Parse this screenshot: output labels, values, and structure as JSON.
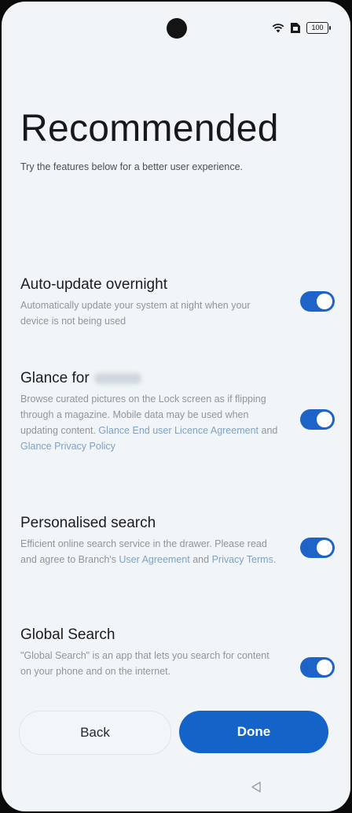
{
  "status_bar": {
    "battery": "100"
  },
  "header": {
    "title": "Recommended",
    "subtitle": "Try the features below for a better user experience."
  },
  "settings": [
    {
      "title": "Auto-update overnight",
      "desc": "Automatically update your system at night when your device is not being used",
      "enabled": true
    },
    {
      "title": "Glance for",
      "desc_plain_1": "Browse curated pictures on the Lock screen as if flipping through a magazine. Mobile data may be used when updating content.",
      "link_1": "Glance End user Licence Agreement",
      "desc_plain_2": "and",
      "link_2": "Glance Privacy Policy",
      "enabled": true
    },
    {
      "title": "Personalised search",
      "desc_plain_1": "Efficient online search service in the drawer. Please read and agree to Branch's",
      "link_1": "User Agreement",
      "desc_plain_2": "and",
      "link_2": "Privacy Terms",
      "desc_end": ".",
      "enabled": true
    },
    {
      "title": "Global Search",
      "desc": "\"Global Search\" is an app that lets you search for content on your phone and on the internet.",
      "enabled": true
    }
  ],
  "buttons": {
    "back": "Back",
    "done": "Done"
  },
  "colors": {
    "accent": "#1463c9",
    "toggle_on": "#1e64c8",
    "link": "#7fa0c4"
  },
  "icons": [
    "wifi-icon",
    "sim-icon",
    "battery-icon",
    "nav-back-icon"
  ]
}
